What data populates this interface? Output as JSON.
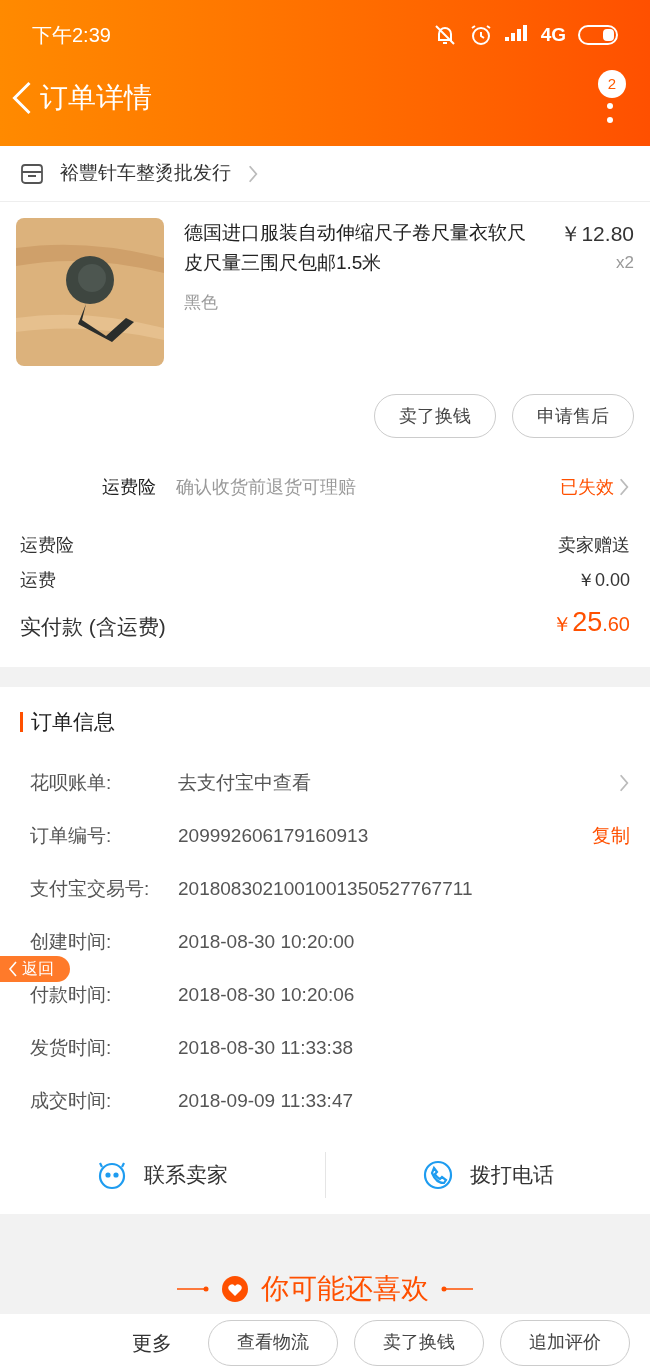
{
  "status_bar": {
    "time": "下午2:39",
    "network": "4G"
  },
  "header": {
    "title": "订单详情",
    "badge": "2"
  },
  "shop": {
    "name": "裕豐针车整烫批发行"
  },
  "product": {
    "title": "德国进口服装自动伸缩尺子卷尺量衣软尺皮尺量三围尺包邮1.5米",
    "variant": "黑色",
    "price": "￥12.80",
    "quantity": "x2"
  },
  "item_buttons": [
    "卖了换钱",
    "申请售后"
  ],
  "insurance": {
    "label": "运费险",
    "description": "确认收货前退货可理赔",
    "status": "已失效"
  },
  "totals": [
    {
      "label": "运费险",
      "value": "卖家赠送"
    },
    {
      "label": "运费",
      "value": "￥0.00"
    }
  ],
  "paid": {
    "label": "实付款 (含运费)",
    "currency": "￥",
    "amount": "25",
    "cents": ".60"
  },
  "order_info": {
    "title": "订单信息",
    "rows": [
      {
        "label": "花呗账单:",
        "value": "去支付宝中查看",
        "has_chevron": true
      },
      {
        "label": "订单编号:",
        "value": "209992606179160913",
        "action": "复制"
      },
      {
        "label": "支付宝交易号:",
        "value": "2018083021001001350527767711"
      },
      {
        "label": "创建时间:",
        "value": "2018-08-30 10:20:00"
      },
      {
        "label": "付款时间:",
        "value": "2018-08-30 10:20:06"
      },
      {
        "label": "发货时间:",
        "value": "2018-08-30 11:33:38"
      },
      {
        "label": "成交时间:",
        "value": "2018-09-09 11:33:47"
      }
    ]
  },
  "float_back": "返回",
  "contact": [
    {
      "kind": "chat",
      "label": "联系卖家"
    },
    {
      "kind": "phone",
      "label": "拨打电话"
    }
  ],
  "recommend": "你可能还喜欢",
  "bottom_bar": {
    "more": "更多",
    "buttons": [
      "查看物流",
      "卖了换钱",
      "追加评价"
    ]
  }
}
